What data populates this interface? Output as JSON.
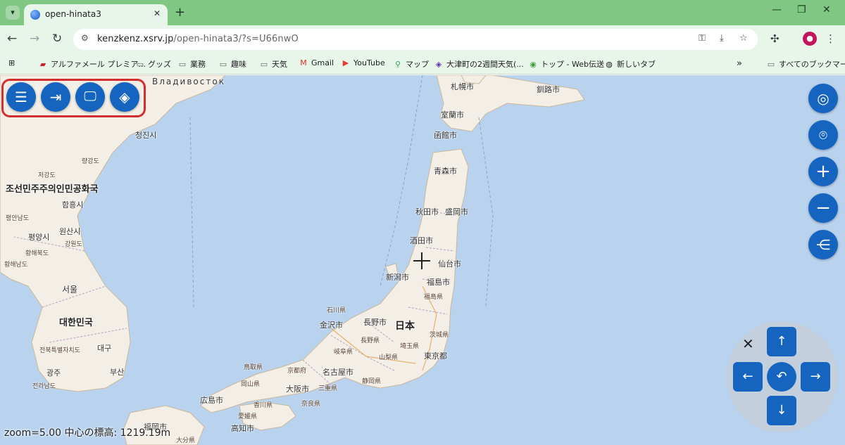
{
  "browser": {
    "tab_title": "open-hinata3",
    "tab_close": "✕",
    "new_tab": "+",
    "url_host": "kenzkenz.xsrv.jp",
    "url_path": "/open-hinata3/?s=U66nwO",
    "window_controls": [
      "—",
      "❐",
      "✕"
    ]
  },
  "bookmarks": [
    {
      "label": "アルファメール プレミア...",
      "icon": "alphamail-icon"
    },
    {
      "label": "グッズ",
      "icon": "folder-icon"
    },
    {
      "label": "業務",
      "icon": "folder-icon"
    },
    {
      "label": "趣味",
      "icon": "folder-icon"
    },
    {
      "label": "天気",
      "icon": "folder-icon"
    },
    {
      "label": "Gmail",
      "icon": "gmail-icon"
    },
    {
      "label": "YouTube",
      "icon": "youtube-icon"
    },
    {
      "label": "マップ",
      "icon": "maps-icon"
    },
    {
      "label": "大津町の2週間天気(...",
      "icon": "weather-icon"
    },
    {
      "label": "トップ - Web伝送",
      "icon": "web-icon"
    },
    {
      "label": "新しいタブ",
      "icon": "globe-icon"
    },
    {
      "label": "すべてのブックマーク",
      "icon": "folder-icon"
    }
  ],
  "bookmarks_more": "»",
  "map": {
    "places": [
      {
        "label": "Владивосток",
        "cls": "mid"
      },
      {
        "label": "札幌市",
        "cls": "mid"
      },
      {
        "label": "釧路市",
        "cls": "mid"
      },
      {
        "label": "室蘭市",
        "cls": "mid"
      },
      {
        "label": "函館市",
        "cls": "mid"
      },
      {
        "label": "청진시",
        "cls": "mid"
      },
      {
        "label": "량강도",
        "cls": "pref"
      },
      {
        "label": "저강도",
        "cls": "pref"
      },
      {
        "label": "조선민주주의인민공화국",
        "cls": "country"
      },
      {
        "label": "함흥시",
        "cls": "mid"
      },
      {
        "label": "평안남도",
        "cls": "pref"
      },
      {
        "label": "평양시",
        "cls": "mid"
      },
      {
        "label": "원산시",
        "cls": "mid"
      },
      {
        "label": "강원도",
        "cls": "pref"
      },
      {
        "label": "황해북도",
        "cls": "pref"
      },
      {
        "label": "황해남도",
        "cls": "pref"
      },
      {
        "label": "서울",
        "cls": "mid"
      },
      {
        "label": "대한민국",
        "cls": "country"
      },
      {
        "label": "전북특별자치도",
        "cls": "pref"
      },
      {
        "label": "대구",
        "cls": "mid"
      },
      {
        "label": "광주",
        "cls": "mid"
      },
      {
        "label": "부산",
        "cls": "mid"
      },
      {
        "label": "전라남도",
        "cls": "pref"
      },
      {
        "label": "青森市",
        "cls": "mid"
      },
      {
        "label": "秋田市",
        "cls": "mid"
      },
      {
        "label": "盛岡市",
        "cls": "mid"
      },
      {
        "label": "酒田市",
        "cls": "mid"
      },
      {
        "label": "仙台市",
        "cls": "mid"
      },
      {
        "label": "新潟市",
        "cls": "mid"
      },
      {
        "label": "福島市",
        "cls": "mid"
      },
      {
        "label": "福島県",
        "cls": "pref"
      },
      {
        "label": "石川県",
        "cls": "pref"
      },
      {
        "label": "金沢市",
        "cls": "mid"
      },
      {
        "label": "長野市",
        "cls": "mid"
      },
      {
        "label": "日本",
        "cls": "big"
      },
      {
        "label": "茨城県",
        "cls": "pref"
      },
      {
        "label": "長野県",
        "cls": "pref"
      },
      {
        "label": "岐阜県",
        "cls": "pref"
      },
      {
        "label": "埼玉県",
        "cls": "pref"
      },
      {
        "label": "山梨県",
        "cls": "pref"
      },
      {
        "label": "東京都",
        "cls": "mid"
      },
      {
        "label": "鳥取県",
        "cls": "pref"
      },
      {
        "label": "京都府",
        "cls": "pref"
      },
      {
        "label": "名古屋市",
        "cls": "mid"
      },
      {
        "label": "岡山県",
        "cls": "pref"
      },
      {
        "label": "静岡県",
        "cls": "pref"
      },
      {
        "label": "大阪市",
        "cls": "mid"
      },
      {
        "label": "三重県",
        "cls": "pref"
      },
      {
        "label": "広島市",
        "cls": "mid"
      },
      {
        "label": "香川県",
        "cls": "pref"
      },
      {
        "label": "奈良県",
        "cls": "pref"
      },
      {
        "label": "愛媛県",
        "cls": "pref"
      },
      {
        "label": "高知市",
        "cls": "mid"
      },
      {
        "label": "福岡市",
        "cls": "mid"
      },
      {
        "label": "大分県",
        "cls": "pref"
      }
    ],
    "status": "zoom=5.00 中心の標高: 1219.19m"
  },
  "left_controls": [
    {
      "name": "menu-button",
      "icon": "menu-icon",
      "glyph": "☰"
    },
    {
      "name": "login-button",
      "icon": "login-icon",
      "glyph": "⇥"
    },
    {
      "name": "display-button",
      "icon": "monitor-icon",
      "glyph": "🖵"
    },
    {
      "name": "layers-button",
      "icon": "layers-icon",
      "glyph": "◈"
    }
  ],
  "right_controls": [
    {
      "name": "my-location-button",
      "icon": "crosshair-target-icon",
      "glyph": "◎"
    },
    {
      "name": "location-pin-button",
      "icon": "map-pin-icon",
      "glyph": "⌾"
    },
    {
      "name": "zoom-in-button",
      "icon": "plus-icon",
      "glyph": "+"
    },
    {
      "name": "zoom-out-button",
      "icon": "minus-icon",
      "glyph": "−"
    },
    {
      "name": "share-button",
      "icon": "share-icon",
      "glyph": "⋲"
    }
  ],
  "dpad": {
    "close": "✕",
    "up": "↑",
    "down": "↓",
    "left": "←",
    "right": "→",
    "reset": "↶"
  },
  "colors": {
    "accent": "#1565c0",
    "tabstrip": "#81c784",
    "toolbar": "#e8f5e9",
    "highlight": "#d32f2f",
    "sea": "#b9d3ee",
    "land": "#f3efe6"
  }
}
